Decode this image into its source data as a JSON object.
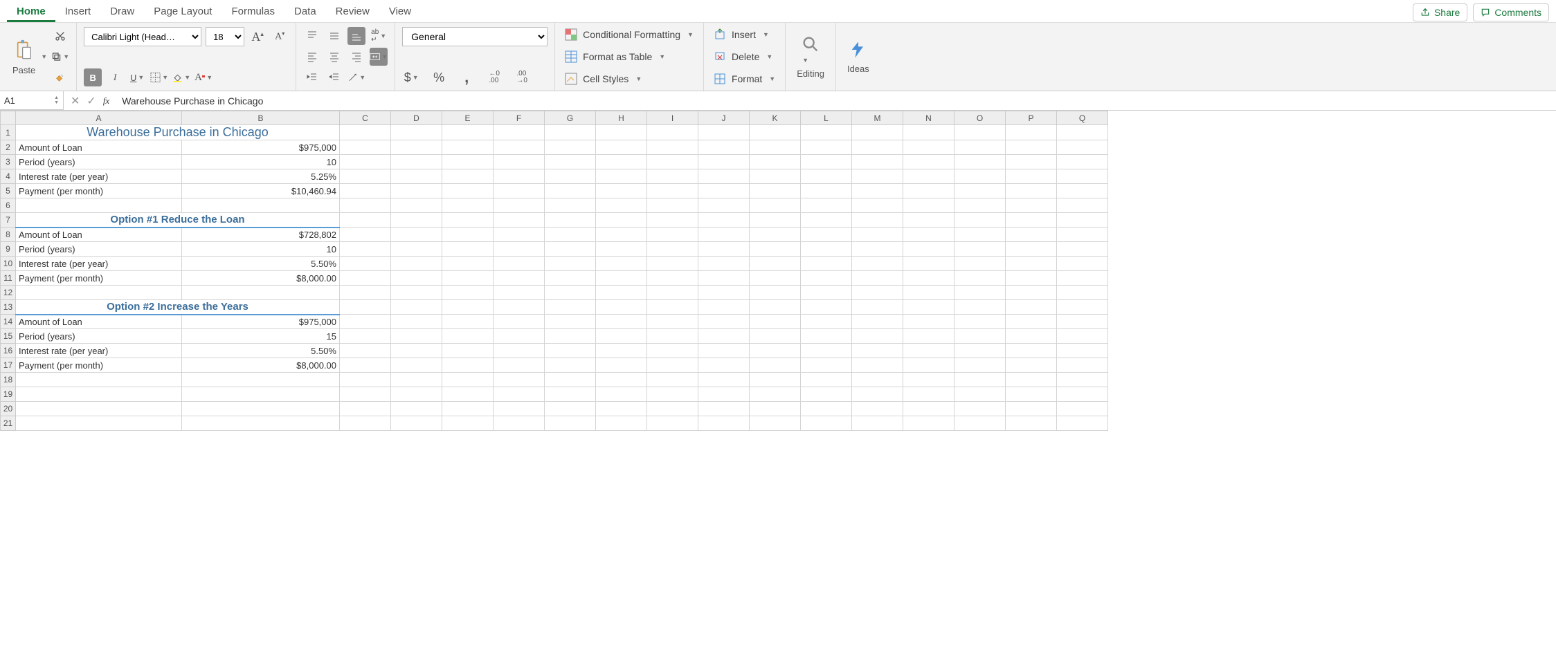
{
  "tabs": [
    "Home",
    "Insert",
    "Draw",
    "Page Layout",
    "Formulas",
    "Data",
    "Review",
    "View"
  ],
  "active_tab": 0,
  "share": "Share",
  "comments": "Comments",
  "ribbon": {
    "paste": "Paste",
    "font_name": "Calibri Light (Head…",
    "font_size": "18",
    "number_format": "General",
    "cond_fmt": "Conditional Formatting",
    "fmt_table": "Format as Table",
    "cell_styles": "Cell Styles",
    "insert": "Insert",
    "delete": "Delete",
    "format": "Format",
    "editing": "Editing",
    "ideas": "Ideas"
  },
  "namebox": "A1",
  "formula": "Warehouse Purchase in Chicago",
  "columns": [
    "A",
    "B",
    "C",
    "D",
    "E",
    "F",
    "G",
    "H",
    "I",
    "J",
    "K",
    "L",
    "M",
    "N",
    "O",
    "P",
    "Q"
  ],
  "rows": [
    {
      "n": 1,
      "a": "Warehouse Purchase in Chicago",
      "b": "",
      "type": "title"
    },
    {
      "n": 2,
      "a": "Amount of Loan",
      "b": "$975,000"
    },
    {
      "n": 3,
      "a": "Period (years)",
      "b": "10"
    },
    {
      "n": 4,
      "a": "Interest rate (per year)",
      "b": "5.25%"
    },
    {
      "n": 5,
      "a": "Payment (per month)",
      "b": "$10,460.94"
    },
    {
      "n": 6,
      "a": "",
      "b": ""
    },
    {
      "n": 7,
      "a": "Option #1 Reduce the Loan",
      "b": "",
      "type": "subhead"
    },
    {
      "n": 8,
      "a": "Amount of Loan",
      "b": "$728,802"
    },
    {
      "n": 9,
      "a": "Period (years)",
      "b": "10"
    },
    {
      "n": 10,
      "a": "Interest rate (per year)",
      "b": "5.50%"
    },
    {
      "n": 11,
      "a": "Payment (per month)",
      "b": "$8,000.00"
    },
    {
      "n": 12,
      "a": "",
      "b": ""
    },
    {
      "n": 13,
      "a": "Option #2 Increase the Years",
      "b": "",
      "type": "subhead"
    },
    {
      "n": 14,
      "a": "Amount of Loan",
      "b": "$975,000"
    },
    {
      "n": 15,
      "a": "Period (years)",
      "b": "15"
    },
    {
      "n": 16,
      "a": "Interest rate (per year)",
      "b": "5.50%"
    },
    {
      "n": 17,
      "a": "Payment (per month)",
      "b": "$8,000.00"
    },
    {
      "n": 18,
      "a": "",
      "b": ""
    },
    {
      "n": 19,
      "a": "",
      "b": ""
    },
    {
      "n": 20,
      "a": "",
      "b": ""
    },
    {
      "n": 21,
      "a": "",
      "b": ""
    }
  ]
}
